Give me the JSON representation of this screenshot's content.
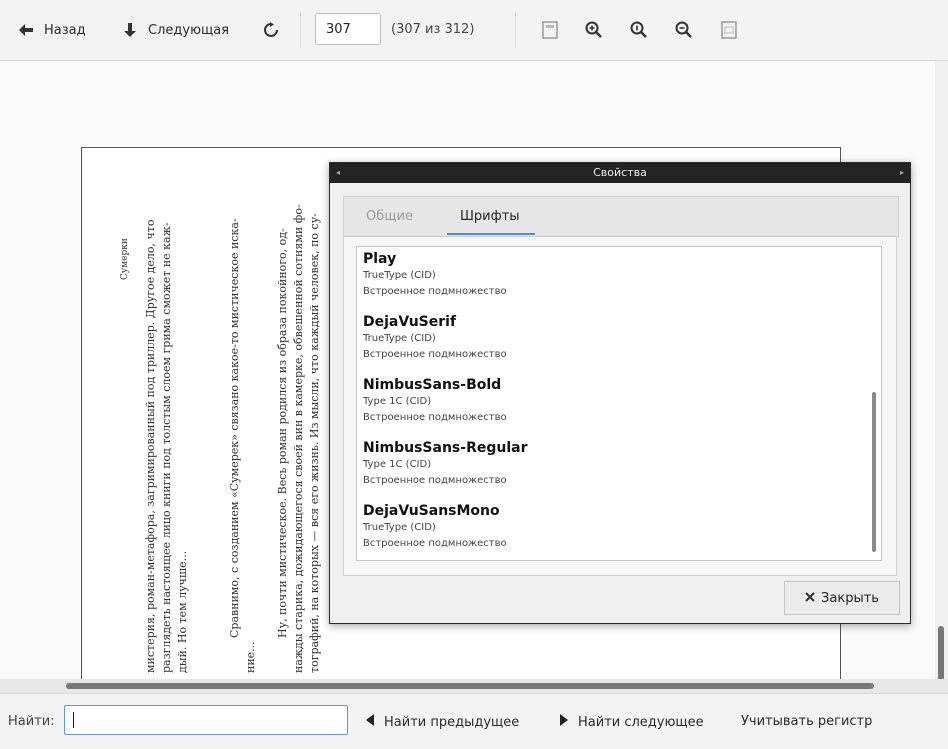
{
  "toolbar": {
    "back_label": "Назад",
    "next_label": "Следующая",
    "page_value": "307",
    "page_count": "(307 из 312)"
  },
  "document": {
    "lines": [
      "Сумерки",
      "мистерия, роман-метафора, загримированный под триллер. Другое дело, что",
      "разглядеть настоящее лицо книги под толстым слоем грима сможет не каж-",
      "дый. Но тем лучше...",
      "Сравнимо, с созданием «Сумерек» связано какое-то мистическое иска-",
      "ние...",
      "Ну, почти мистическое. Весь роман родился из образа покойного, од-",
      "нажды старика, дожидающегося своей вин в камерке, обвешенной сотнями фо-",
      "тографий, на которых — вся его жизнь. Из мысли, что каждый человек, по су-"
    ]
  },
  "dialog": {
    "title": "Свойства",
    "tabs": [
      "Общие",
      "Шрифты"
    ],
    "active_tab": "Шрифты",
    "fonts": [
      {
        "name": "Play",
        "type": "TrueType (CID)",
        "embedding": "Встроенное подмножество"
      },
      {
        "name": "DejaVuSerif",
        "type": "TrueType (CID)",
        "embedding": "Встроенное подмножество"
      },
      {
        "name": "NimbusSans-Bold",
        "type": "Type 1C (CID)",
        "embedding": "Встроенное подмножество"
      },
      {
        "name": "NimbusSans-Regular",
        "type": "Type 1C (CID)",
        "embedding": "Встроенное подмножество"
      },
      {
        "name": "DejaVuSansMono",
        "type": "TrueType (CID)",
        "embedding": "Встроенное подмножество"
      }
    ],
    "close_label": "Закрыть"
  },
  "findbar": {
    "label": "Найти:",
    "value": "",
    "prev_label": "Найти предыдущее",
    "next_label": "Найти следующее",
    "case_label": "Учитывать регистр"
  },
  "colors": {
    "accent": "#4a90d9",
    "titlebar": "#232323"
  }
}
